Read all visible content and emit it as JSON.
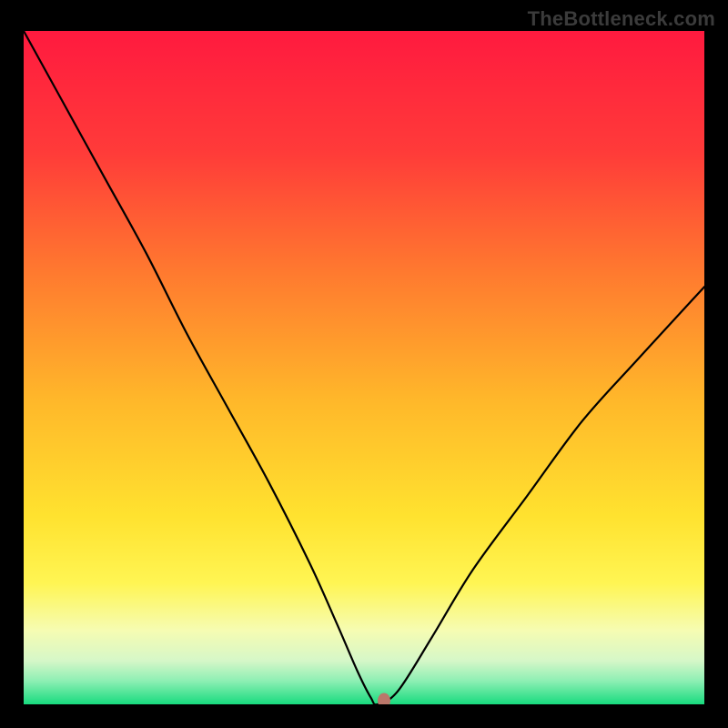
{
  "watermark": "TheBottleneck.com",
  "chart_data": {
    "type": "line",
    "title": "",
    "xlabel": "",
    "ylabel": "",
    "xlim": [
      0,
      100
    ],
    "ylim": [
      0,
      100
    ],
    "gradient_stops": [
      {
        "offset": 0.0,
        "color": "#ff1a3f"
      },
      {
        "offset": 0.18,
        "color": "#ff3b39"
      },
      {
        "offset": 0.36,
        "color": "#ff7a2f"
      },
      {
        "offset": 0.55,
        "color": "#ffb82a"
      },
      {
        "offset": 0.72,
        "color": "#ffe22f"
      },
      {
        "offset": 0.82,
        "color": "#fff553"
      },
      {
        "offset": 0.89,
        "color": "#f6fcb2"
      },
      {
        "offset": 0.935,
        "color": "#d6f7c8"
      },
      {
        "offset": 0.965,
        "color": "#8eefb4"
      },
      {
        "offset": 1.0,
        "color": "#18db7e"
      }
    ],
    "series": [
      {
        "name": "bottleneck-curve",
        "x": [
          0,
          6,
          12,
          18,
          24,
          30,
          36,
          42,
          46,
          49,
          51,
          52,
          55,
          60,
          66,
          74,
          82,
          90,
          100
        ],
        "values": [
          100,
          89,
          78,
          67,
          55,
          44,
          33,
          21,
          12,
          5,
          1,
          0,
          2,
          10,
          20,
          31,
          42,
          51,
          62
        ]
      }
    ],
    "marker": {
      "name": "optimal-point",
      "x": 53,
      "y": 0
    }
  }
}
